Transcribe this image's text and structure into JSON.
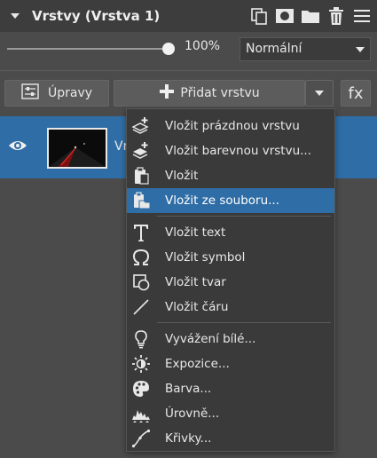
{
  "panel": {
    "title": "Vrstvy (Vrstva 1)"
  },
  "opacity": {
    "value_label": "100%",
    "level": 1.0
  },
  "blend_mode": {
    "selected": "Normální"
  },
  "toolbar": {
    "upravy_label": "Úpravy",
    "pridat_label": "Přidat vrstvu",
    "fx_label": "fx"
  },
  "layer": {
    "name_partial": "Vr"
  },
  "menu": {
    "items": [
      {
        "label": "Vložit prázdnou vrstvu",
        "icon": "layers-plus-icon"
      },
      {
        "label": "Vložit barevnou vrstvu...",
        "icon": "color-layer-plus-icon"
      },
      {
        "label": "Vložit",
        "icon": "paste-icon"
      },
      {
        "label": "Vložit ze souboru...",
        "icon": "paste-from-file-icon"
      },
      {
        "label": "Vložit text",
        "icon": "text-icon"
      },
      {
        "label": "Vložit symbol",
        "icon": "omega-icon"
      },
      {
        "label": "Vložit tvar",
        "icon": "shape-icon"
      },
      {
        "label": "Vložit čáru",
        "icon": "line-icon"
      },
      {
        "label": "Vyvážení bílé...",
        "icon": "bulb-icon"
      },
      {
        "label": "Expozice...",
        "icon": "sun-icon"
      },
      {
        "label": "Barva...",
        "icon": "palette-icon"
      },
      {
        "label": "Úrovně...",
        "icon": "histogram-icon"
      },
      {
        "label": "Křivky...",
        "icon": "curve-icon"
      }
    ],
    "highlighted_index": 3
  },
  "colors": {
    "panel_bg": "#4b4b4b",
    "header_bg": "#3d3d3d",
    "selection_blue": "#2f6da6",
    "menu_bg": "#3a3a3a"
  }
}
